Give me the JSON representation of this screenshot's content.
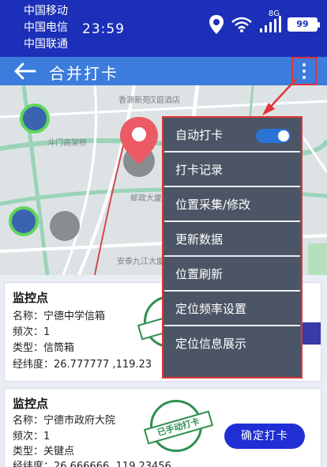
{
  "status_bar": {
    "carriers": [
      "中国移动",
      "中国电信",
      "中国联通"
    ],
    "time": "23:59",
    "network": "8G",
    "battery": "99"
  },
  "header": {
    "title": "合并打卡"
  },
  "map": {
    "labels": [
      "汉庭酒店",
      "斗门高架桥",
      "邮政大厦",
      "安泰九江大厦",
      "香源新苑"
    ]
  },
  "menu": {
    "items": [
      {
        "label": "自动打卡",
        "toggle_on": true
      },
      {
        "label": "打卡记录"
      },
      {
        "label": "位置采集/修改"
      },
      {
        "label": "更新数据"
      },
      {
        "label": "位置刷新"
      },
      {
        "label": "定位频率设置"
      },
      {
        "label": "定位信息展示"
      }
    ]
  },
  "cards": [
    {
      "title": "监控点",
      "name": "名称：宁德中学信箱",
      "freq": "频次：1",
      "type": "类型：信筒箱",
      "coords": "经纬度：26.777777 ,119.23",
      "stamp": "已"
    },
    {
      "title": "监控点",
      "name": "名称：宁德市政府大院",
      "freq": "频次：1",
      "type": "类型：关键点",
      "coords": "经纬度：26.666666 ,119.23456",
      "stamp": "已手动打卡",
      "button": "确定打卡"
    }
  ],
  "colors": {
    "status_bar": "#1c2fb8",
    "header": "#3b7cdc",
    "menu_bg": "#4c5565",
    "highlight": "#e23434",
    "confirm_button": "#1f2fd4",
    "stamp": "#2f8f50"
  }
}
